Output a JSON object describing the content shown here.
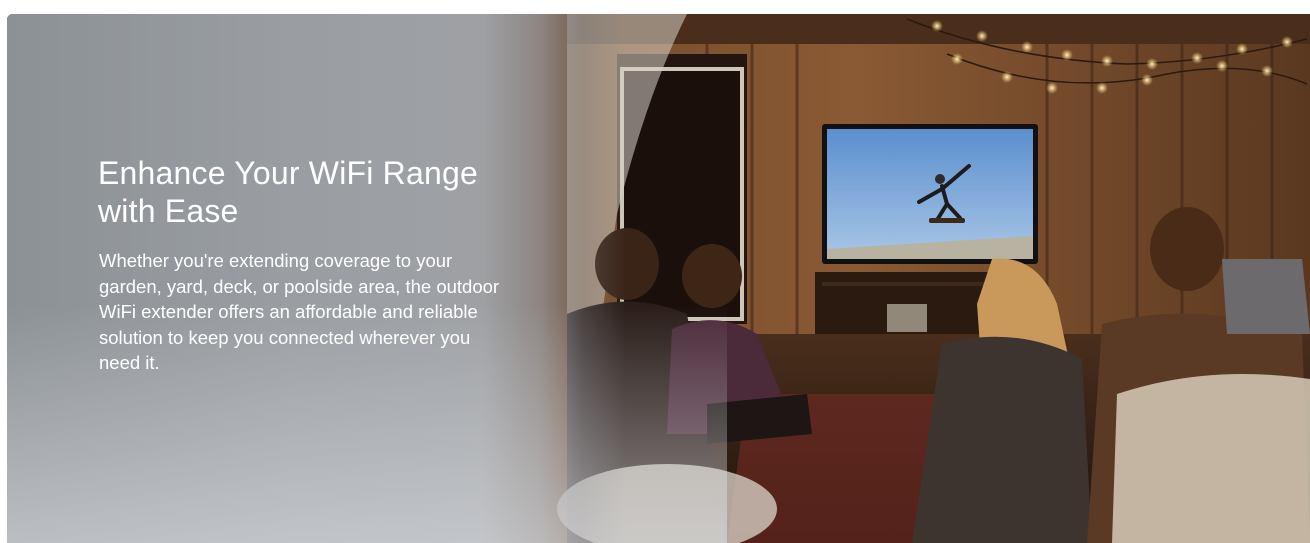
{
  "hero": {
    "headline": "Enhance Your WiFi Range with Ease",
    "body": "Whether you're extending coverage to your garden, yard, deck, or poolside area, the outdoor WiFi extender offers an affordable and reliable solution to keep you connected wherever you need it.",
    "image_subject": "friends watching a skateboarder on a TV in a wooden cabin with string lights",
    "colors": {
      "panel": "#9a9ea3",
      "text": "#ffffff",
      "wood": "#6b4226",
      "tv_sky": "#4a7fc0"
    }
  }
}
